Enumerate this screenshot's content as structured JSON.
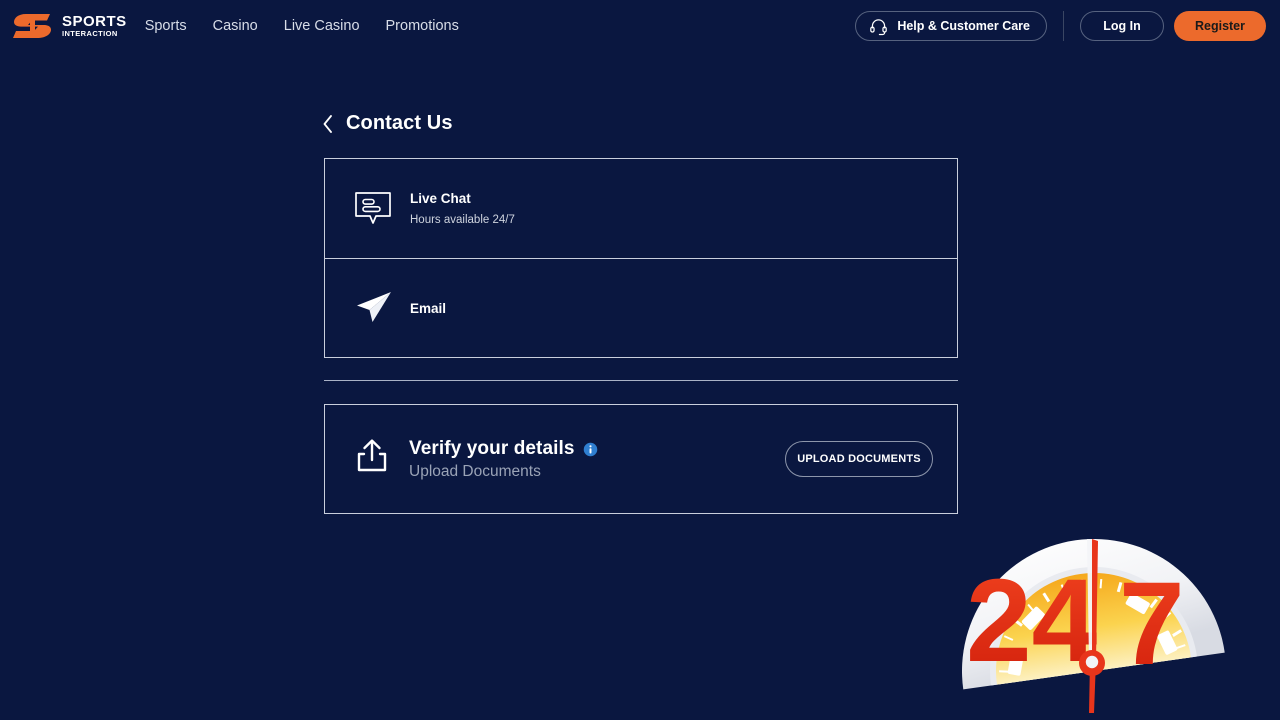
{
  "brand": {
    "logo_line1": "SPORTS",
    "logo_line2": "INTERACTION",
    "accent_color": "#ec6a2c",
    "background_color": "#0a1740"
  },
  "header": {
    "nav": [
      {
        "label": "Sports"
      },
      {
        "label": "Casino"
      },
      {
        "label": "Live Casino"
      },
      {
        "label": "Promotions"
      }
    ],
    "help_label": "Help & Customer Care",
    "login_label": "Log In",
    "register_label": "Register"
  },
  "page": {
    "title": "Contact Us"
  },
  "contact_methods": [
    {
      "title": "Live Chat",
      "subtitle": "Hours available 24/7",
      "icon": "chat-bubble-icon"
    },
    {
      "title": "Email",
      "subtitle": "",
      "icon": "paper-plane-icon"
    }
  ],
  "verify": {
    "title": "Verify your details",
    "subtitle": "Upload Documents",
    "info_icon": "info-icon",
    "upload_icon": "upload-icon",
    "button_label": "UPLOAD DOCUMENTS"
  },
  "artwork": {
    "gauge_label_left": "24",
    "gauge_label_right": "7",
    "gauge_separator": "/",
    "dial_color": "#f6b731",
    "numeral_color": "#e8351b"
  }
}
